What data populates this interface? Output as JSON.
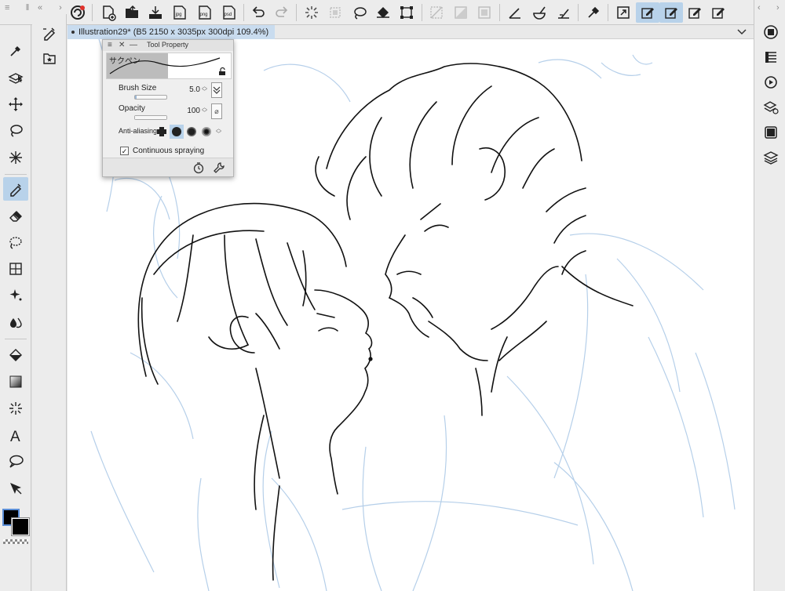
{
  "document": {
    "tab_title": "Illustration29* (B5 2150 x 3035px 300dpi 109.4%)"
  },
  "tool_property": {
    "panel_title": "Tool Property",
    "brush_name": "サクペン",
    "brush_size_label": "Brush Size",
    "brush_size_value": "5.0",
    "opacity_label": "Opacity",
    "opacity_value": "100",
    "antialiasing_label": "Anti-aliasing",
    "continuous_spraying_label": "Continuous spraying",
    "continuous_spraying_checked": true,
    "brush_size_fraction": 0.05,
    "opacity_fraction": 1.0
  },
  "colors": {
    "accent_selection": "#b8d2ea",
    "main_color": "#000000",
    "sub_color": "#000000",
    "sketch_layer": "#a9c7e6"
  },
  "top_toolbar": {
    "icons": [
      "clip-studio-logo-icon",
      "new-canvas-icon",
      "open-file-icon",
      "save-icon",
      "export-jpg-icon",
      "export-png-icon",
      "export-psd-icon",
      "undo-icon",
      "redo-icon",
      "clear-selection-icon",
      "clear-layer-icon",
      "lasso-selection-icon",
      "fill-icon",
      "transform-icon",
      "deselect-icon",
      "invert-selection-icon",
      "selection-border-icon",
      "ruler-angle-icon",
      "ruler-curve-icon",
      "ruler-snap-icon",
      "eyedropper-icon",
      "expand-icon",
      "edit-pen-1-icon",
      "edit-pen-2-icon",
      "edit-pen-3-icon",
      "edit-pen-4-icon"
    ],
    "export_labels": [
      "jpg",
      "png",
      "psd"
    ]
  },
  "left_toolbar": {
    "tools": [
      "eyedropper-tool",
      "layer-move-tool",
      "move-tool",
      "lasso-tool",
      "magic-wand-tool",
      "pen-tool",
      "eraser-tool",
      "lasso-fill-tool",
      "mesh-transform-tool",
      "decoration-tool",
      "blend-tool",
      "fill-tool",
      "gradient-tool",
      "figure-tool",
      "text-tool",
      "balloon-tool",
      "correct-line-tool"
    ],
    "active_tool": "pen-tool"
  },
  "sub_toolbar": {
    "icons": [
      "pen-subtool-icon",
      "sub-tool-group-icon"
    ]
  },
  "right_toolbar": {
    "icons": [
      "navigator-icon",
      "layer-property-icon",
      "search-layer-icon",
      "material-icon",
      "animation-icon",
      "layer-icon"
    ]
  }
}
